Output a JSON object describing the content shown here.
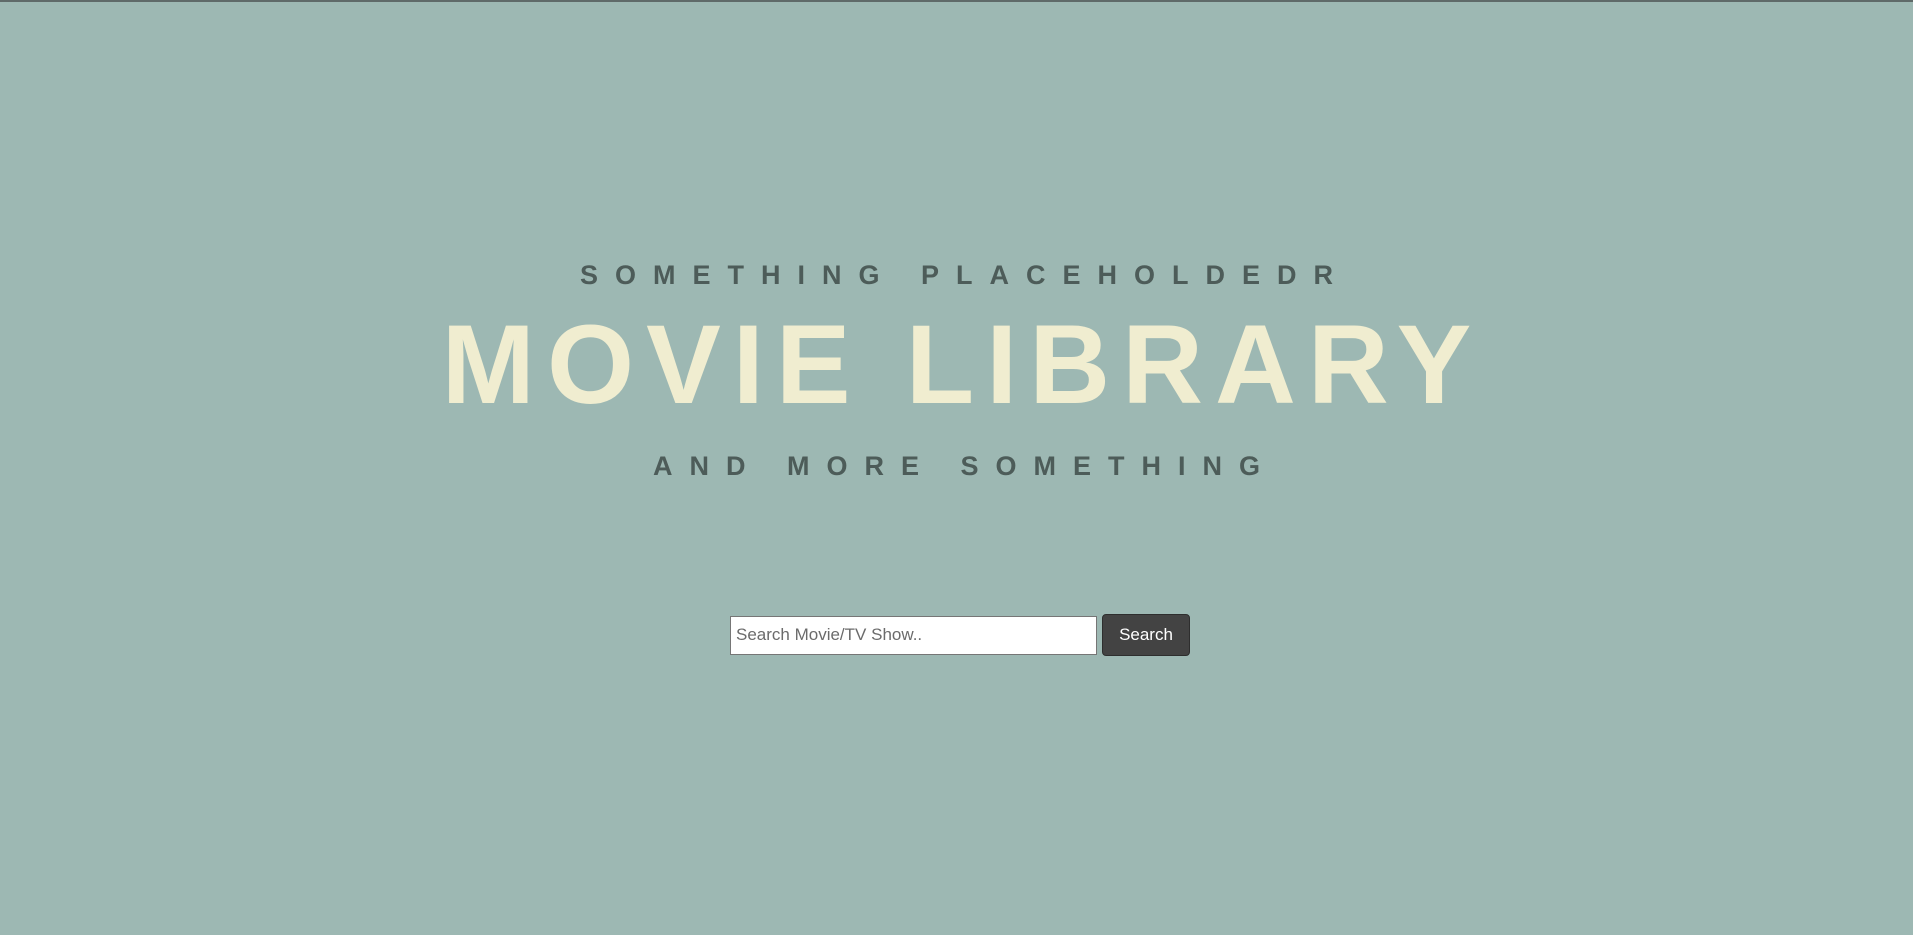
{
  "hero": {
    "tagline_top": "SOMETHING PLACEHOLDEDR",
    "title": "MOVIE LIBRARY",
    "tagline_bottom": "AND MORE SOMETHING"
  },
  "search": {
    "placeholder": "Search Movie/TV Show..",
    "value": "",
    "button_label": "Search"
  },
  "colors": {
    "background": "#9db8b3",
    "title": "#f0edd0",
    "tagline": "#4d5c59",
    "button": "#434343"
  }
}
